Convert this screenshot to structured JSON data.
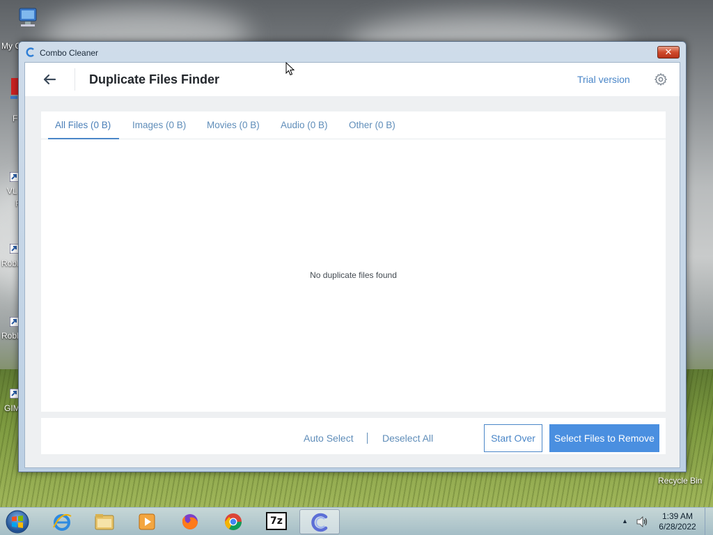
{
  "desktop": {
    "icons": [
      {
        "label": "My C"
      },
      {
        "label": "F"
      },
      {
        "label": "VL"
      },
      {
        "label": "F"
      },
      {
        "label": "Robl"
      },
      {
        "label": "Robl"
      },
      {
        "label": "GIM"
      }
    ],
    "recycle_bin_label": "Recycle Bin"
  },
  "window": {
    "title": "Combo Cleaner",
    "close_glyph": "✕"
  },
  "app": {
    "page_title": "Duplicate Files Finder",
    "trial_label": "Trial version",
    "back_icon": "arrow-left-icon",
    "settings_icon": "gear-icon",
    "tabs": [
      {
        "label": "All Files (0 B)",
        "active": true
      },
      {
        "label": "Images (0 B)",
        "active": false
      },
      {
        "label": "Movies (0 B)",
        "active": false
      },
      {
        "label": "Audio (0 B)",
        "active": false
      },
      {
        "label": "Other (0 B)",
        "active": false
      }
    ],
    "empty_message": "No duplicate files found",
    "footer": {
      "auto_select": "Auto Select",
      "deselect_all": "Deselect All",
      "start_over": "Start Over",
      "select_files": "Select Files to Remove"
    },
    "accent_color": "#4a8fe0"
  },
  "taskbar": {
    "items": [
      {
        "name": "internet-explorer-icon"
      },
      {
        "name": "file-explorer-icon"
      },
      {
        "name": "media-player-icon"
      },
      {
        "name": "firefox-icon"
      },
      {
        "name": "chrome-icon"
      },
      {
        "name": "7zip-icon",
        "label": "7z"
      },
      {
        "name": "combo-cleaner-icon",
        "active": true
      }
    ],
    "time": "1:39 AM",
    "date": "6/28/2022"
  }
}
